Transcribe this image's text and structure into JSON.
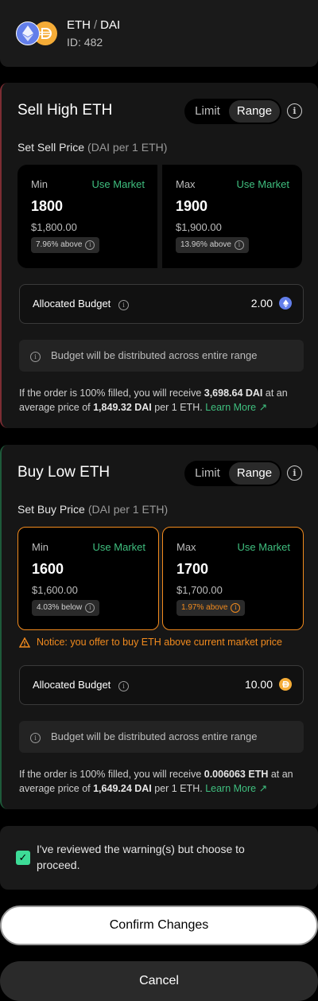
{
  "header": {
    "base": "ETH",
    "separator": "/",
    "quote": "DAI",
    "id_label": "ID: 482"
  },
  "sell": {
    "title": "Sell High ETH",
    "toggle": {
      "limit": "Limit",
      "range": "Range",
      "selected": "Range"
    },
    "price_label": "Set Sell Price",
    "price_unit": "(DAI per 1 ETH)",
    "min": {
      "label": "Min",
      "use_market": "Use Market",
      "value": "1800",
      "usd": "$1,800.00",
      "badge": "7.96% above"
    },
    "max": {
      "label": "Max",
      "use_market": "Use Market",
      "value": "1900",
      "usd": "$1,900.00",
      "badge": "13.96% above"
    },
    "budget": {
      "label": "Allocated Budget",
      "value": "2.00",
      "token_icon": "eth-icon"
    },
    "dist_note": "Budget will be distributed across entire range",
    "summary": {
      "p1": "If the order is 100% filled, you will receive ",
      "amount": "3,698.64 DAI",
      "p2": " at an average price of ",
      "price": "1,849.32 DAI",
      "p3": " per 1 ETH.",
      "learn_more": "Learn More"
    }
  },
  "buy": {
    "title": "Buy Low ETH",
    "toggle": {
      "limit": "Limit",
      "range": "Range",
      "selected": "Range"
    },
    "price_label": "Set Buy Price",
    "price_unit": "(DAI per 1 ETH)",
    "min": {
      "label": "Min",
      "use_market": "Use Market",
      "value": "1600",
      "usd": "$1,600.00",
      "badge": "4.03% below"
    },
    "max": {
      "label": "Max",
      "use_market": "Use Market",
      "value": "1700",
      "usd": "$1,700.00",
      "badge": "1.97% above"
    },
    "notice": "Notice: you offer to buy ETH above current market price",
    "budget": {
      "label": "Allocated Budget",
      "value": "10.00",
      "token_icon": "dai-icon"
    },
    "dist_note": "Budget will be distributed across entire range",
    "summary": {
      "p1": "If the order is 100% filled, you will receive ",
      "amount": "0.006063 ETH",
      "p2": " at an average price of ",
      "price": "1,649.24 DAI",
      "p3": " per 1 ETH.",
      "learn_more": "Learn More"
    }
  },
  "ack": {
    "checked": true,
    "text": "I've reviewed the warning(s) but choose to proceed."
  },
  "buttons": {
    "confirm": "Confirm Changes",
    "cancel": "Cancel"
  },
  "colors": {
    "accent_green": "#3fbf7f",
    "warning_orange": "#f28b1e",
    "sell_border": "#7d2d33",
    "buy_border": "#1e5a3a",
    "eth": "#627eea",
    "dai": "#f5ac37"
  }
}
